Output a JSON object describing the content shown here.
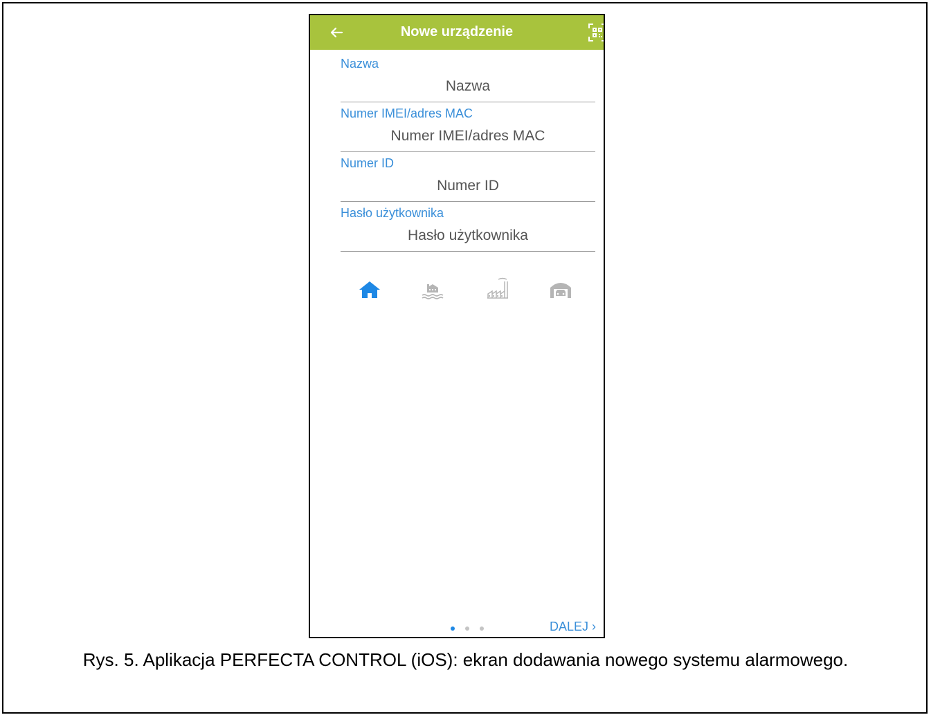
{
  "header": {
    "title": "Nowe urządzenie",
    "bar_color": "#a8c33d",
    "back_icon": "arrow-left-icon",
    "qr_icon": "qr-code-scan-icon"
  },
  "form": {
    "fields": [
      {
        "label": "Nazwa",
        "placeholder": "Nazwa"
      },
      {
        "label": "Numer IMEI/adres MAC",
        "placeholder": "Numer IMEI/adres MAC"
      },
      {
        "label": "Numer ID",
        "placeholder": "Numer ID"
      },
      {
        "label": "Hasło użytkownika",
        "placeholder": "Hasło użytkownika"
      }
    ],
    "label_color": "#3a8fd9"
  },
  "object_types": [
    {
      "icon": "house-icon",
      "selected": true
    },
    {
      "icon": "waterfront-house-icon",
      "selected": false
    },
    {
      "icon": "factory-icon",
      "selected": false
    },
    {
      "icon": "garage-icon",
      "selected": false
    }
  ],
  "pager": {
    "pages": 3,
    "current": 1,
    "next_label": "DALEJ ›"
  },
  "caption": "Rys. 5. Aplikacja PERFECTA CONTROL (iOS): ekran dodawania nowego systemu alarmowego."
}
